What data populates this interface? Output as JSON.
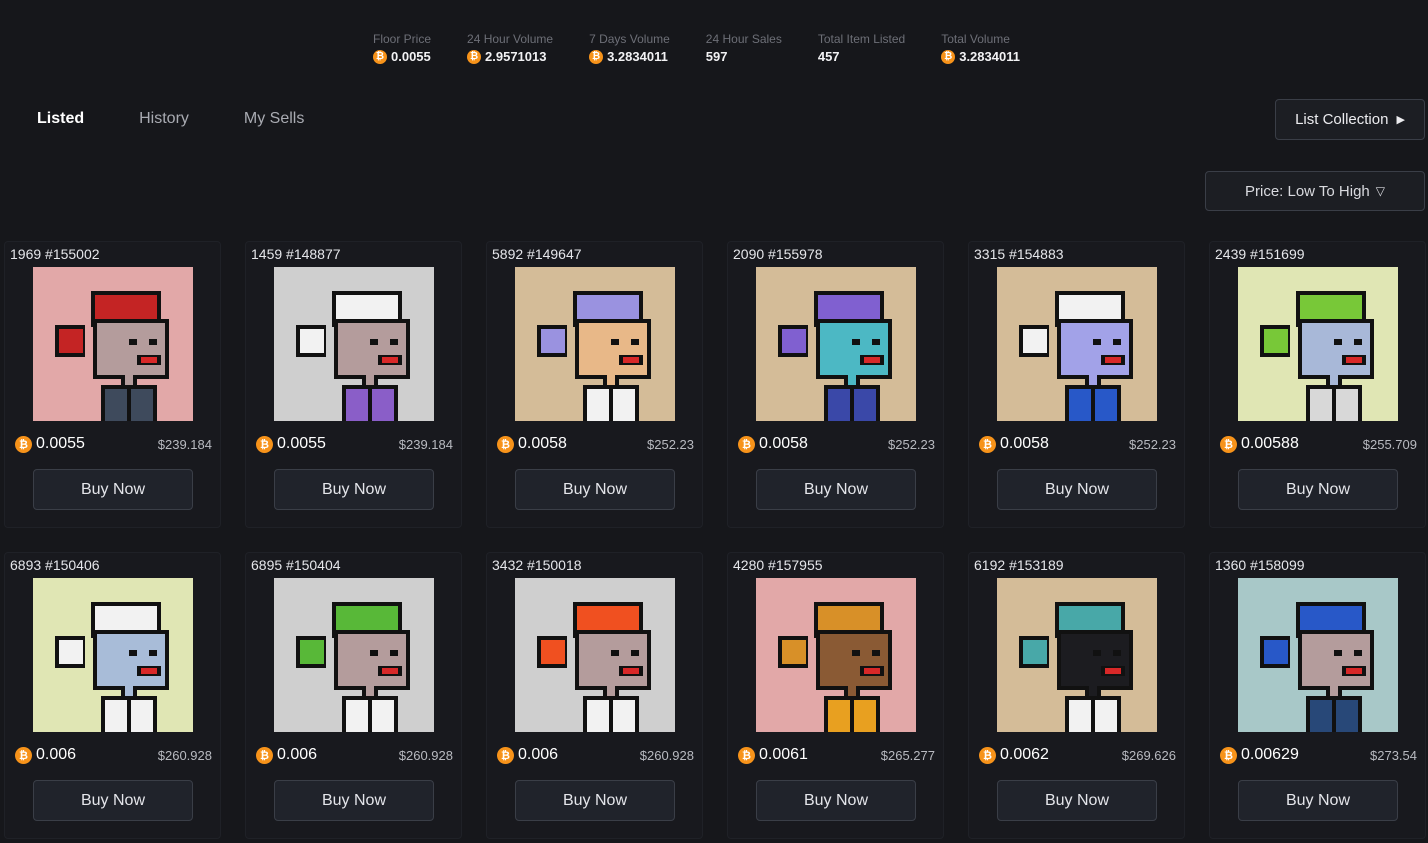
{
  "stats": [
    {
      "label": "Floor Price",
      "value": "0.0055",
      "btc": true
    },
    {
      "label": "24 Hour Volume",
      "value": "2.9571013",
      "btc": true
    },
    {
      "label": "7 Days Volume",
      "value": "3.2834011",
      "btc": true
    },
    {
      "label": "24 Hour Sales",
      "value": "597",
      "btc": false
    },
    {
      "label": "Total Item Listed",
      "value": "457",
      "btc": false
    },
    {
      "label": "Total Volume",
      "value": "3.2834011",
      "btc": true
    }
  ],
  "tabs": [
    {
      "label": "Listed",
      "active": true
    },
    {
      "label": "History",
      "active": false
    },
    {
      "label": "My Sells",
      "active": false
    }
  ],
  "list_collection_label": "List Collection",
  "sort_label": "Price: Low To High",
  "btc_symbol": "₿",
  "buy_label": "Buy Now",
  "items": [
    {
      "title": "1969 #155002",
      "price": "0.0055",
      "usd": "$239.184",
      "bg": "#e2a8a8",
      "head": "#c42424",
      "face": "#b49c9c",
      "body": "#3e4a5c"
    },
    {
      "title": "1459 #148877",
      "price": "0.0055",
      "usd": "$239.184",
      "bg": "#cfcfcf",
      "head": "#f2f2f2",
      "face": "#b49c9c",
      "body": "#8a5ec8"
    },
    {
      "title": "5892 #149647",
      "price": "0.0058",
      "usd": "$252.23",
      "bg": "#d4bc98",
      "head": "#9a92e0",
      "face": "#e8b888",
      "body": "#f2f2f2"
    },
    {
      "title": "2090 #155978",
      "price": "0.0058",
      "usd": "$252.23",
      "bg": "#d4bc98",
      "head": "#8060d0",
      "face": "#4cb8c4",
      "body": "#3a48a8"
    },
    {
      "title": "3315 #154883",
      "price": "0.0058",
      "usd": "$252.23",
      "bg": "#d4bc98",
      "head": "#f2f2f2",
      "face": "#a2a2e8",
      "body": "#2858c8"
    },
    {
      "title": "2439 #151699",
      "price": "0.00588",
      "usd": "$255.709",
      "bg": "#e0e6b4",
      "head": "#78c838",
      "face": "#a8b8d8",
      "body": "#d8d8d8"
    },
    {
      "title": "6893 #150406",
      "price": "0.006",
      "usd": "$260.928",
      "bg": "#e0e6b4",
      "head": "#f2f2f2",
      "face": "#a8bcd8",
      "body": "#f2f2f2"
    },
    {
      "title": "6895 #150404",
      "price": "0.006",
      "usd": "$260.928",
      "bg": "#cfcfcf",
      "head": "#58b838",
      "face": "#b49c9c",
      "body": "#f2f2f2"
    },
    {
      "title": "3432 #150018",
      "price": "0.006",
      "usd": "$260.928",
      "bg": "#cfcfcf",
      "head": "#f05020",
      "face": "#b49c9c",
      "body": "#f2f2f2"
    },
    {
      "title": "4280 #157955",
      "price": "0.0061",
      "usd": "$265.277",
      "bg": "#e2a8a8",
      "head": "#d89028",
      "face": "#8a5a34",
      "body": "#e8a020"
    },
    {
      "title": "6192 #153189",
      "price": "0.0062",
      "usd": "$269.626",
      "bg": "#d4bc98",
      "head": "#48a8a8",
      "face": "#1c1c20",
      "body": "#f2f2f2"
    },
    {
      "title": "1360 #158099",
      "price": "0.00629",
      "usd": "$273.54",
      "bg": "#a8c8c8",
      "head": "#2858c8",
      "face": "#b49c9c",
      "body": "#284878"
    }
  ]
}
